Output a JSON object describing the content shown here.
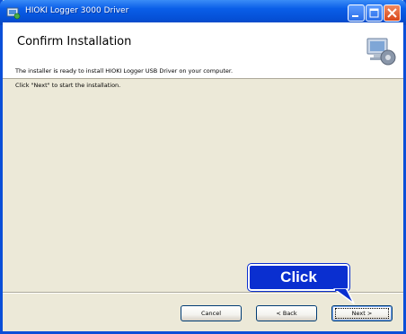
{
  "window": {
    "title": "HIOKI Logger 3000 Driver",
    "icon": "installer-icon",
    "controls": {
      "minimize_icon": "minimize-icon",
      "maximize_icon": "maximize-icon",
      "close_icon": "close-icon"
    }
  },
  "header": {
    "title": "Confirm Installation",
    "graphic": "computer-setup-icon"
  },
  "body": {
    "line1": "The installer is ready to install HIOKI Logger USB Driver on your computer.",
    "line2": "Click \"Next\" to start the installation."
  },
  "buttons": {
    "cancel": "Cancel",
    "back": "< Back",
    "next": "Next >"
  },
  "callout": {
    "label": "Click"
  },
  "colors": {
    "titlebar": "#0550d6",
    "callout": "#0a2fd0",
    "dialog_face": "#ece9d8"
  }
}
